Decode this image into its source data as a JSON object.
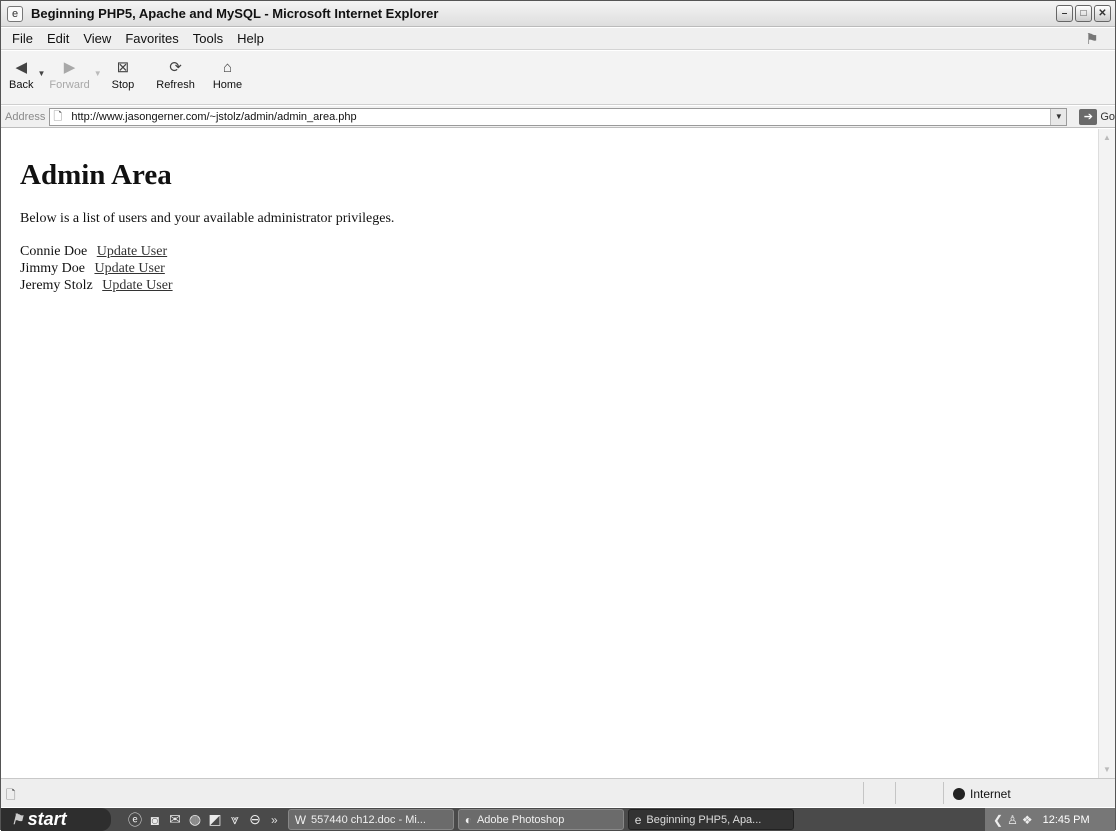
{
  "window": {
    "title": "Beginning PHP5, Apache and MySQL - Microsoft Internet Explorer",
    "controls": [
      "–",
      "□",
      "✕"
    ]
  },
  "menu": [
    "File",
    "Edit",
    "View",
    "Favorites",
    "Tools",
    "Help"
  ],
  "toolbar": {
    "back": "Back",
    "forward": "Forward",
    "stop": "Stop",
    "refresh": "Refresh",
    "home": "Home"
  },
  "address": {
    "label": "Address",
    "url": "http://www.jasongerner.com/~jstolz/admin/admin_area.php",
    "go": "Go"
  },
  "page": {
    "heading": "Admin Area",
    "intro": "Below is a list of users and your available administrator privileges.",
    "users": [
      {
        "name": "Connie Doe",
        "link": "Update User"
      },
      {
        "name": "Jimmy Doe",
        "link": "Update User"
      },
      {
        "name": "Jeremy Stolz",
        "link": "Update User"
      }
    ]
  },
  "status": {
    "zone": "Internet"
  },
  "taskbar": {
    "start": "start",
    "tasks": [
      {
        "label": "557440 ch12.doc - Mi...",
        "icon": "W"
      },
      {
        "label": "Adobe Photoshop",
        "icon": "◐"
      },
      {
        "label": "Beginning PHP5, Apa...",
        "icon": "e"
      }
    ],
    "clock": "12:45 PM"
  }
}
